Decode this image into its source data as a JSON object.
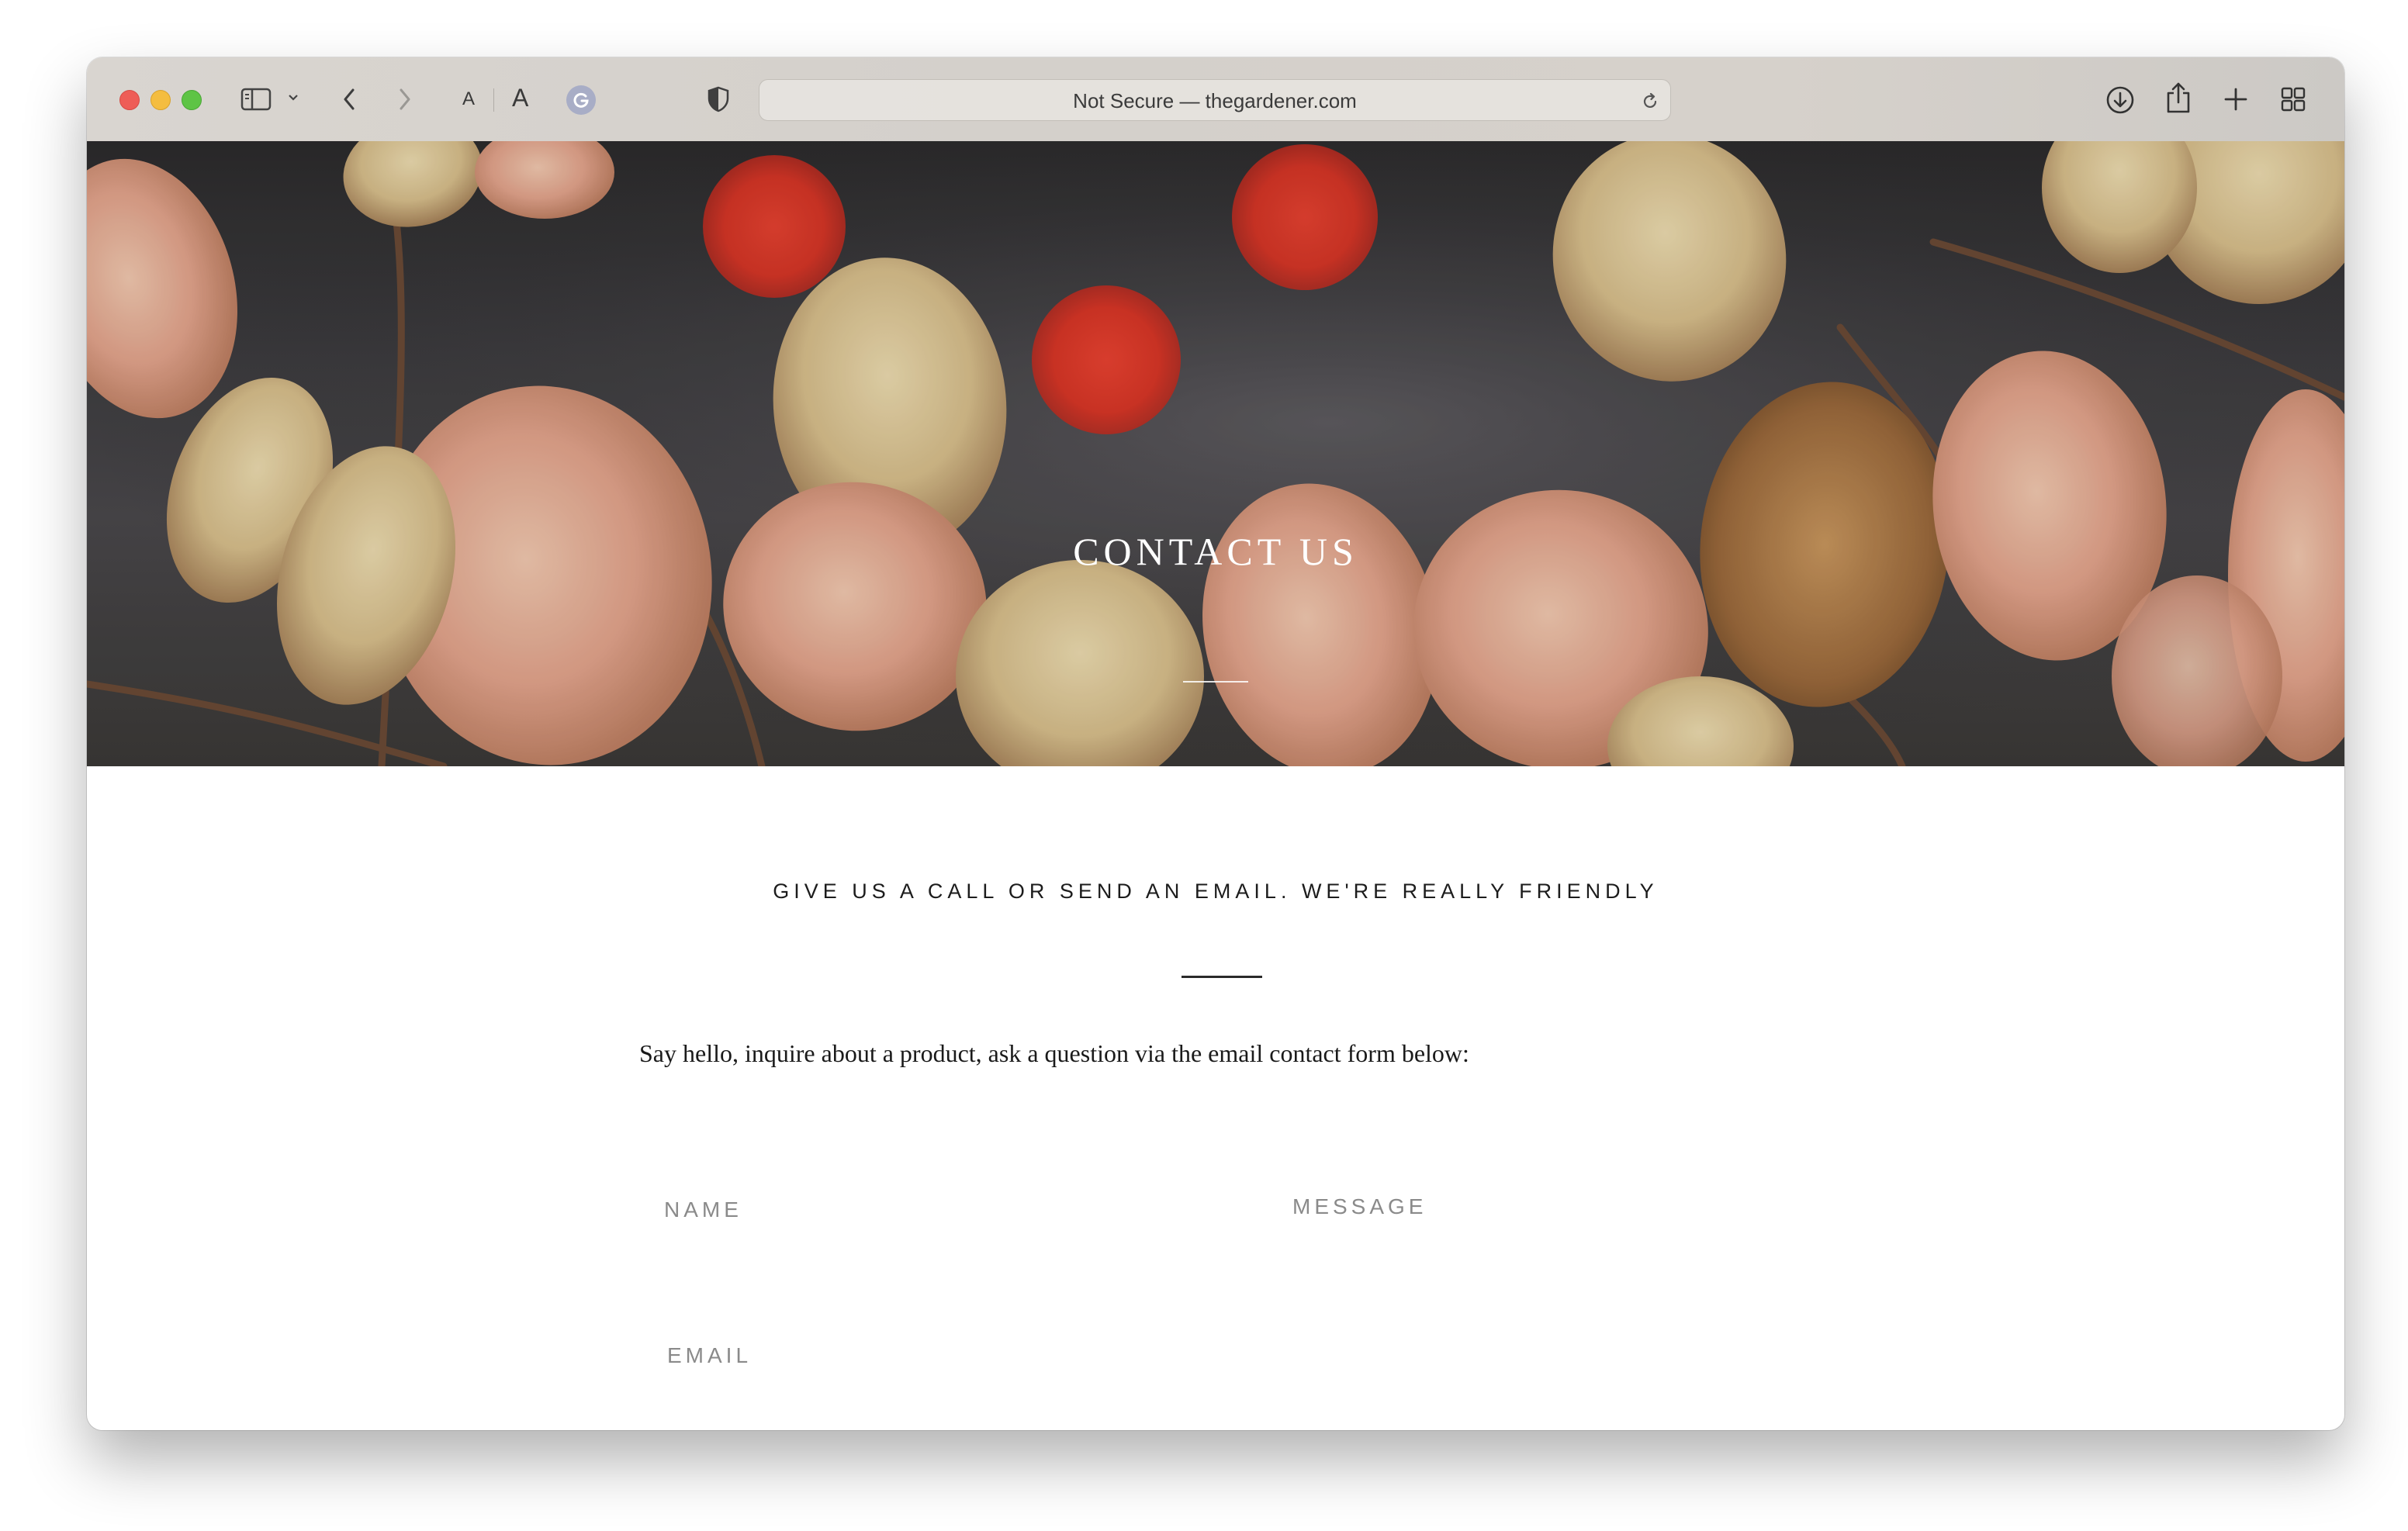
{
  "browser": {
    "address": "Not Secure — thegardener.com",
    "font_small_label": "A",
    "font_large_label": "A",
    "icons": [
      "sidebar-icon",
      "chevron-down-icon",
      "back-icon",
      "forward-icon",
      "grammarly-icon",
      "privacy-shield-icon",
      "reload-icon",
      "download-icon",
      "share-icon",
      "new-tab-icon",
      "tab-overview-icon"
    ]
  },
  "hero": {
    "title": "CONTACT US"
  },
  "content": {
    "tagline": "GIVE US A CALL OR SEND AN EMAIL. WE'RE REALLY FRIENDLY",
    "intro": "Say hello, inquire about a product, ask a question via the email contact form below:"
  },
  "form": {
    "name_label": "NAME",
    "message_label": "MESSAGE",
    "email_label": "EMAIL"
  },
  "colors": {
    "traffic_red": "#ee5d57",
    "traffic_yellow": "#f4bd40",
    "traffic_green": "#5ec445",
    "bokeh_red": "#e03a2c",
    "leaf_pink": "#e8a58c",
    "label_gray": "#8a8a8a"
  }
}
